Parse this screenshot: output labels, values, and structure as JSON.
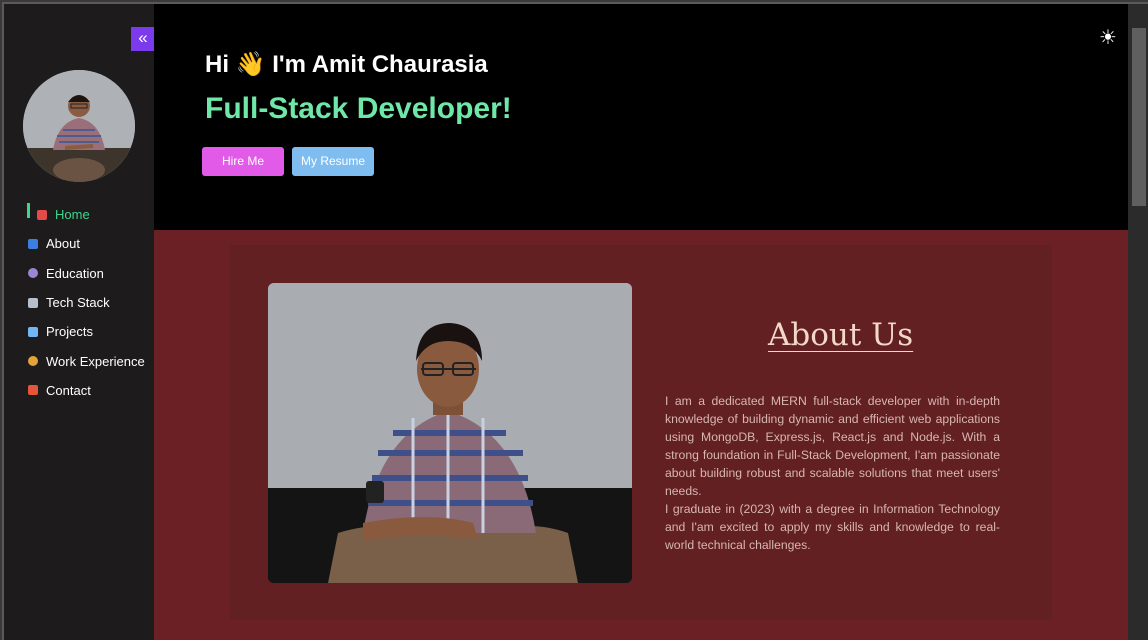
{
  "sidebar": {
    "collapse_icon": "double-chevron-left-icon",
    "avatar": "profile-photo",
    "items": [
      {
        "label": "Home",
        "icon": "home-icon",
        "color": "#e34b4b"
      },
      {
        "label": "About",
        "icon": "info-icon",
        "color": "#3d7fe0"
      },
      {
        "label": "Education",
        "icon": "student-icon",
        "color": "#9b86d6"
      },
      {
        "label": "Tech Stack",
        "icon": "tools-icon",
        "color": "#b6c0cc"
      },
      {
        "label": "Projects",
        "icon": "document-icon",
        "color": "#71b6f5"
      },
      {
        "label": "Work Experience",
        "icon": "worker-icon",
        "color": "#e3a33b"
      },
      {
        "label": "Contact",
        "icon": "phone-icon",
        "color": "#e5553a"
      }
    ],
    "active": "Home"
  },
  "hero": {
    "greeting_hi": "Hi",
    "greeting_emoji": "👋",
    "greeting_name": "I'm Amit Chaurasia",
    "role": "Full-Stack Developer!",
    "hire_label": "Hire Me",
    "resume_label": "My Resume",
    "theme_icon": "sun-icon"
  },
  "about": {
    "title": "About Us",
    "paragraph1": "I am a dedicated MERN full-stack developer with in-depth knowledge of building dynamic and efficient web applications using MongoDB, Express.js, React.js and Node.js. With a strong foundation in Full-Stack Development, I'am passionate about building robust and scalable solutions that meet users' needs.",
    "paragraph2": "I graduate in (2023) with a degree in Information Technology and I'am excited to apply my skills and knowledge to real-world technical challenges."
  },
  "colors": {
    "accent": "#7c3aed",
    "active_nav": "#3dd68c",
    "role_text": "#6ee7a8",
    "hire_button": "#e25be8",
    "resume_button": "#7fbdf1",
    "about_bg": "#6a2024"
  }
}
